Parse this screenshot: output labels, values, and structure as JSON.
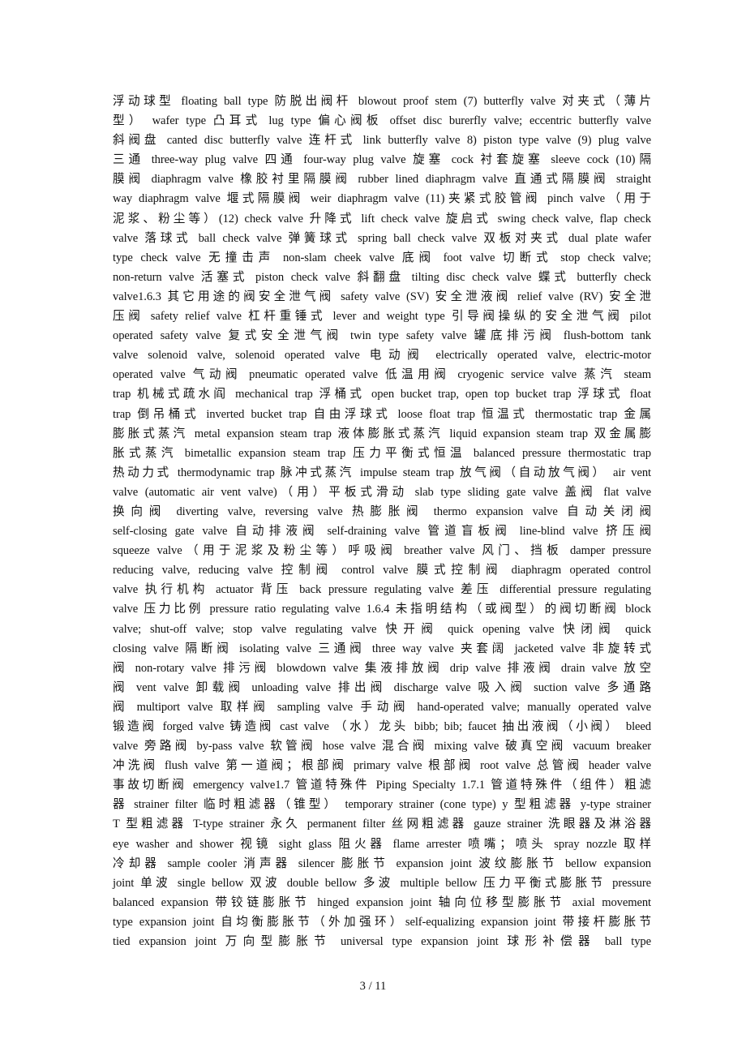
{
  "document": {
    "lines": [
      "浮动球型  floating ball type  防脱出阀杆  blowout proof stem (7) butterfly valve  对夹式（薄片",
      "型）  wafer type  凸耳式  lug type  偏心阀板  offset disc burerfly valve; eccentric butterfly valve",
      "斜阀盘  canted disc butterfly valve  连杆式  link butterfly valve 8) piston type valve (9) plug valve",
      "三通  three-way plug valve  四通  four-way plug valve  旋塞  cock  衬套旋塞  sleeve cock (10)隔",
      "膜阀  diaphragm valve  橡胶衬里隔膜阀  rubber lined diaphragm valve  直通式隔膜阀  straight",
      "way diaphragm valve  堰式隔膜阀  weir diaphragm valve (11)夹紧式胶管阀  pinch valve（用于",
      "泥浆、粉尘等）(12) check valve  升降式  lift check valve  旋启式  swing check valve, flap check",
      "valve  落球式  ball check valve  弹簧球式  spring ball check valve  双板对夹式  dual plate wafer",
      "type check valve  无撞击声  non-slam cheek valve  底阀  foot valve  切断式  stop check valve;",
      "non-return valve  活塞式  piston check valve  斜翻盘  tilting disc check valve  蝶式  butterfly check",
      "valve1.6.3 其它用途的阀安全泄气阀  safety valve (SV)  安全泄液阀  relief valve (RV)  安全泄",
      "压阀  safety relief valve  杠杆重锤式  lever and weight type  引导阀操纵的安全泄气阀  pilot",
      "operated safety valve  复式安全泄气阀  twin type safety valve  罐底排污阀  flush-bottom tank",
      "valve solenoid valve, solenoid operated valve  电动阀  electrically operated valve, electric-motor",
      "operated valve  气动阀  pneumatic operated valve  低温用阀  cryogenic service valve  蒸汽  steam",
      "trap  机械式疏水阎  mechanical trap  浮桶式  open bucket trap, open top bucket trap  浮球式  float",
      "trap  倒吊桶式  inverted bucket trap  自由浮球式  loose float trap  恒温式  thermostatic trap  金属",
      "膨胀式蒸汽  metal expansion steam trap  液体膨胀式蒸汽  liquid expansion steam trap  双金属膨",
      "胀式蒸汽  bimetallic expansion steam trap  压力平衡式恒温  balanced pressure thermostatic trap",
      "热动力式  thermodynamic trap  脉冲式蒸汽  impulse steam trap  放气阀（自动放气阀）  air vent",
      "valve (automatic air vent valve)（用）平板式滑动  slab type sliding gate valve  盖阀  flat valve",
      "换向阀  diverting valve, reversing valve  热膨胀阀  thermo expansion valve  自动关闭阀",
      "self-closing gate valve  自动排液阀  self-draining valve  管道盲板阀  line-blind valve  挤压阀",
      "squeeze valve（用于泥浆及粉尘等）呼吸阀  breather valve  风门、挡板  damper pressure",
      "reducing valve, reducing valve  控制阀  control valve  膜式控制阀  diaphragm operated control",
      "valve  执行机构  actuator  背压  back pressure regulating valve  差压  differential pressure regulating",
      "valve  压力比例  pressure ratio regulating valve 1.6.4 未指明结构（或阀型）的阀切断阀  block",
      "valve; shut-off valve; stop valve regulating valve  快开阀  quick opening valve  快闭阀  quick",
      "closing valve  隔断阀  isolating valve  三通阀  three way valve  夹套阔  jacketed valve  非旋转式",
      "阀  non-rotary valve  排污阀  blowdown valve  集液排放阀  drip valve  排液阀  drain valve  放空",
      "阀  vent valve  卸载阀  unloading valve  排出阀  discharge valve  吸入阀  suction valve  多通路",
      "阀  multiport valve  取样阀  sampling valve  手动阀  hand-operated valve; manually operated valve",
      "锻造阀  forged valve  铸造阀  cast valve  （水）龙头  bibb; bib; faucet  抽出液阀（小阀）  bleed",
      "valve  旁路阀  by-pass valve  软管阀  hose valve  混合阀  mixing valve  破真空阀  vacuum breaker",
      "冲洗阀  flush valve  第一道阀；根部阀  primary valve  根部阀  root valve  总管阀  header valve",
      "事故切断阀  emergency valve1.7 管道特殊件  Piping Specialty 1.7.1 管道特殊件（组件）粗滤",
      "器  strainer filter  临时粗滤器（锥型）  temporary strainer (cone type) y 型粗滤器  y-type strainer",
      "T 型粗滤器  T-type strainer  永久  permanent filter  丝网粗滤器  gauze strainer  洗眼器及淋浴器",
      "eye washer and shower  视镜  sight glass  阻火器  flame arrester  喷嘴；喷头  spray nozzle  取样",
      "冷却器  sample cooler  消声器  silencer  膨胀节  expansion joint  波纹膨胀节  bellow expansion",
      "joint  单波  single bellow  双波  double bellow  多波  multiple bellow  压力平衡式膨胀节  pressure",
      "balanced expansion  带铰链膨胀节  hinged expansion joint  轴向位移型膨胀节  axial movement",
      "type expansion joint  自均衡膨胀节（外加强环）self-equalizing expansion joint  带接杆膨胀节",
      "tied expansion joint  万向型膨胀节  universal type expansion joint  球形补偿器  ball type"
    ]
  },
  "footer": {
    "page_number": "3  / 11"
  }
}
